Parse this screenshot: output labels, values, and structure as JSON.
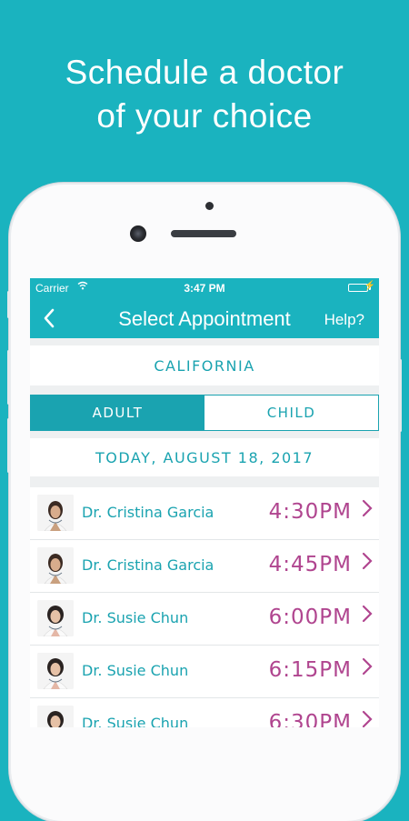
{
  "headline": {
    "line1": "Schedule a doctor",
    "line2": "of your choice"
  },
  "status_bar": {
    "carrier": "Carrier",
    "wifi_icon": "wifi-icon",
    "time": "3:47 PM",
    "battery_icon": "battery-icon"
  },
  "nav": {
    "back_icon": "chevron-left-icon",
    "title": "Select Appointment",
    "help": "Help?"
  },
  "state": "CALIFORNIA",
  "patient_type": {
    "options": [
      "ADULT",
      "CHILD"
    ],
    "selected": "ADULT"
  },
  "date_label": "TODAY, AUGUST 18, 2017",
  "appointments": [
    {
      "doctor": "Dr. Cristina Garcia",
      "time": "4:30PM"
    },
    {
      "doctor": "Dr. Cristina Garcia",
      "time": "4:45PM"
    },
    {
      "doctor": "Dr. Susie Chun",
      "time": "6:00PM"
    },
    {
      "doctor": "Dr. Susie Chun",
      "time": "6:15PM"
    },
    {
      "doctor": "Dr. Susie Chun",
      "time": "6:30PM"
    }
  ],
  "colors": {
    "brand_teal": "#1ab3bf",
    "accent_teal": "#1aa3b0",
    "time_magenta": "#b0458f"
  }
}
